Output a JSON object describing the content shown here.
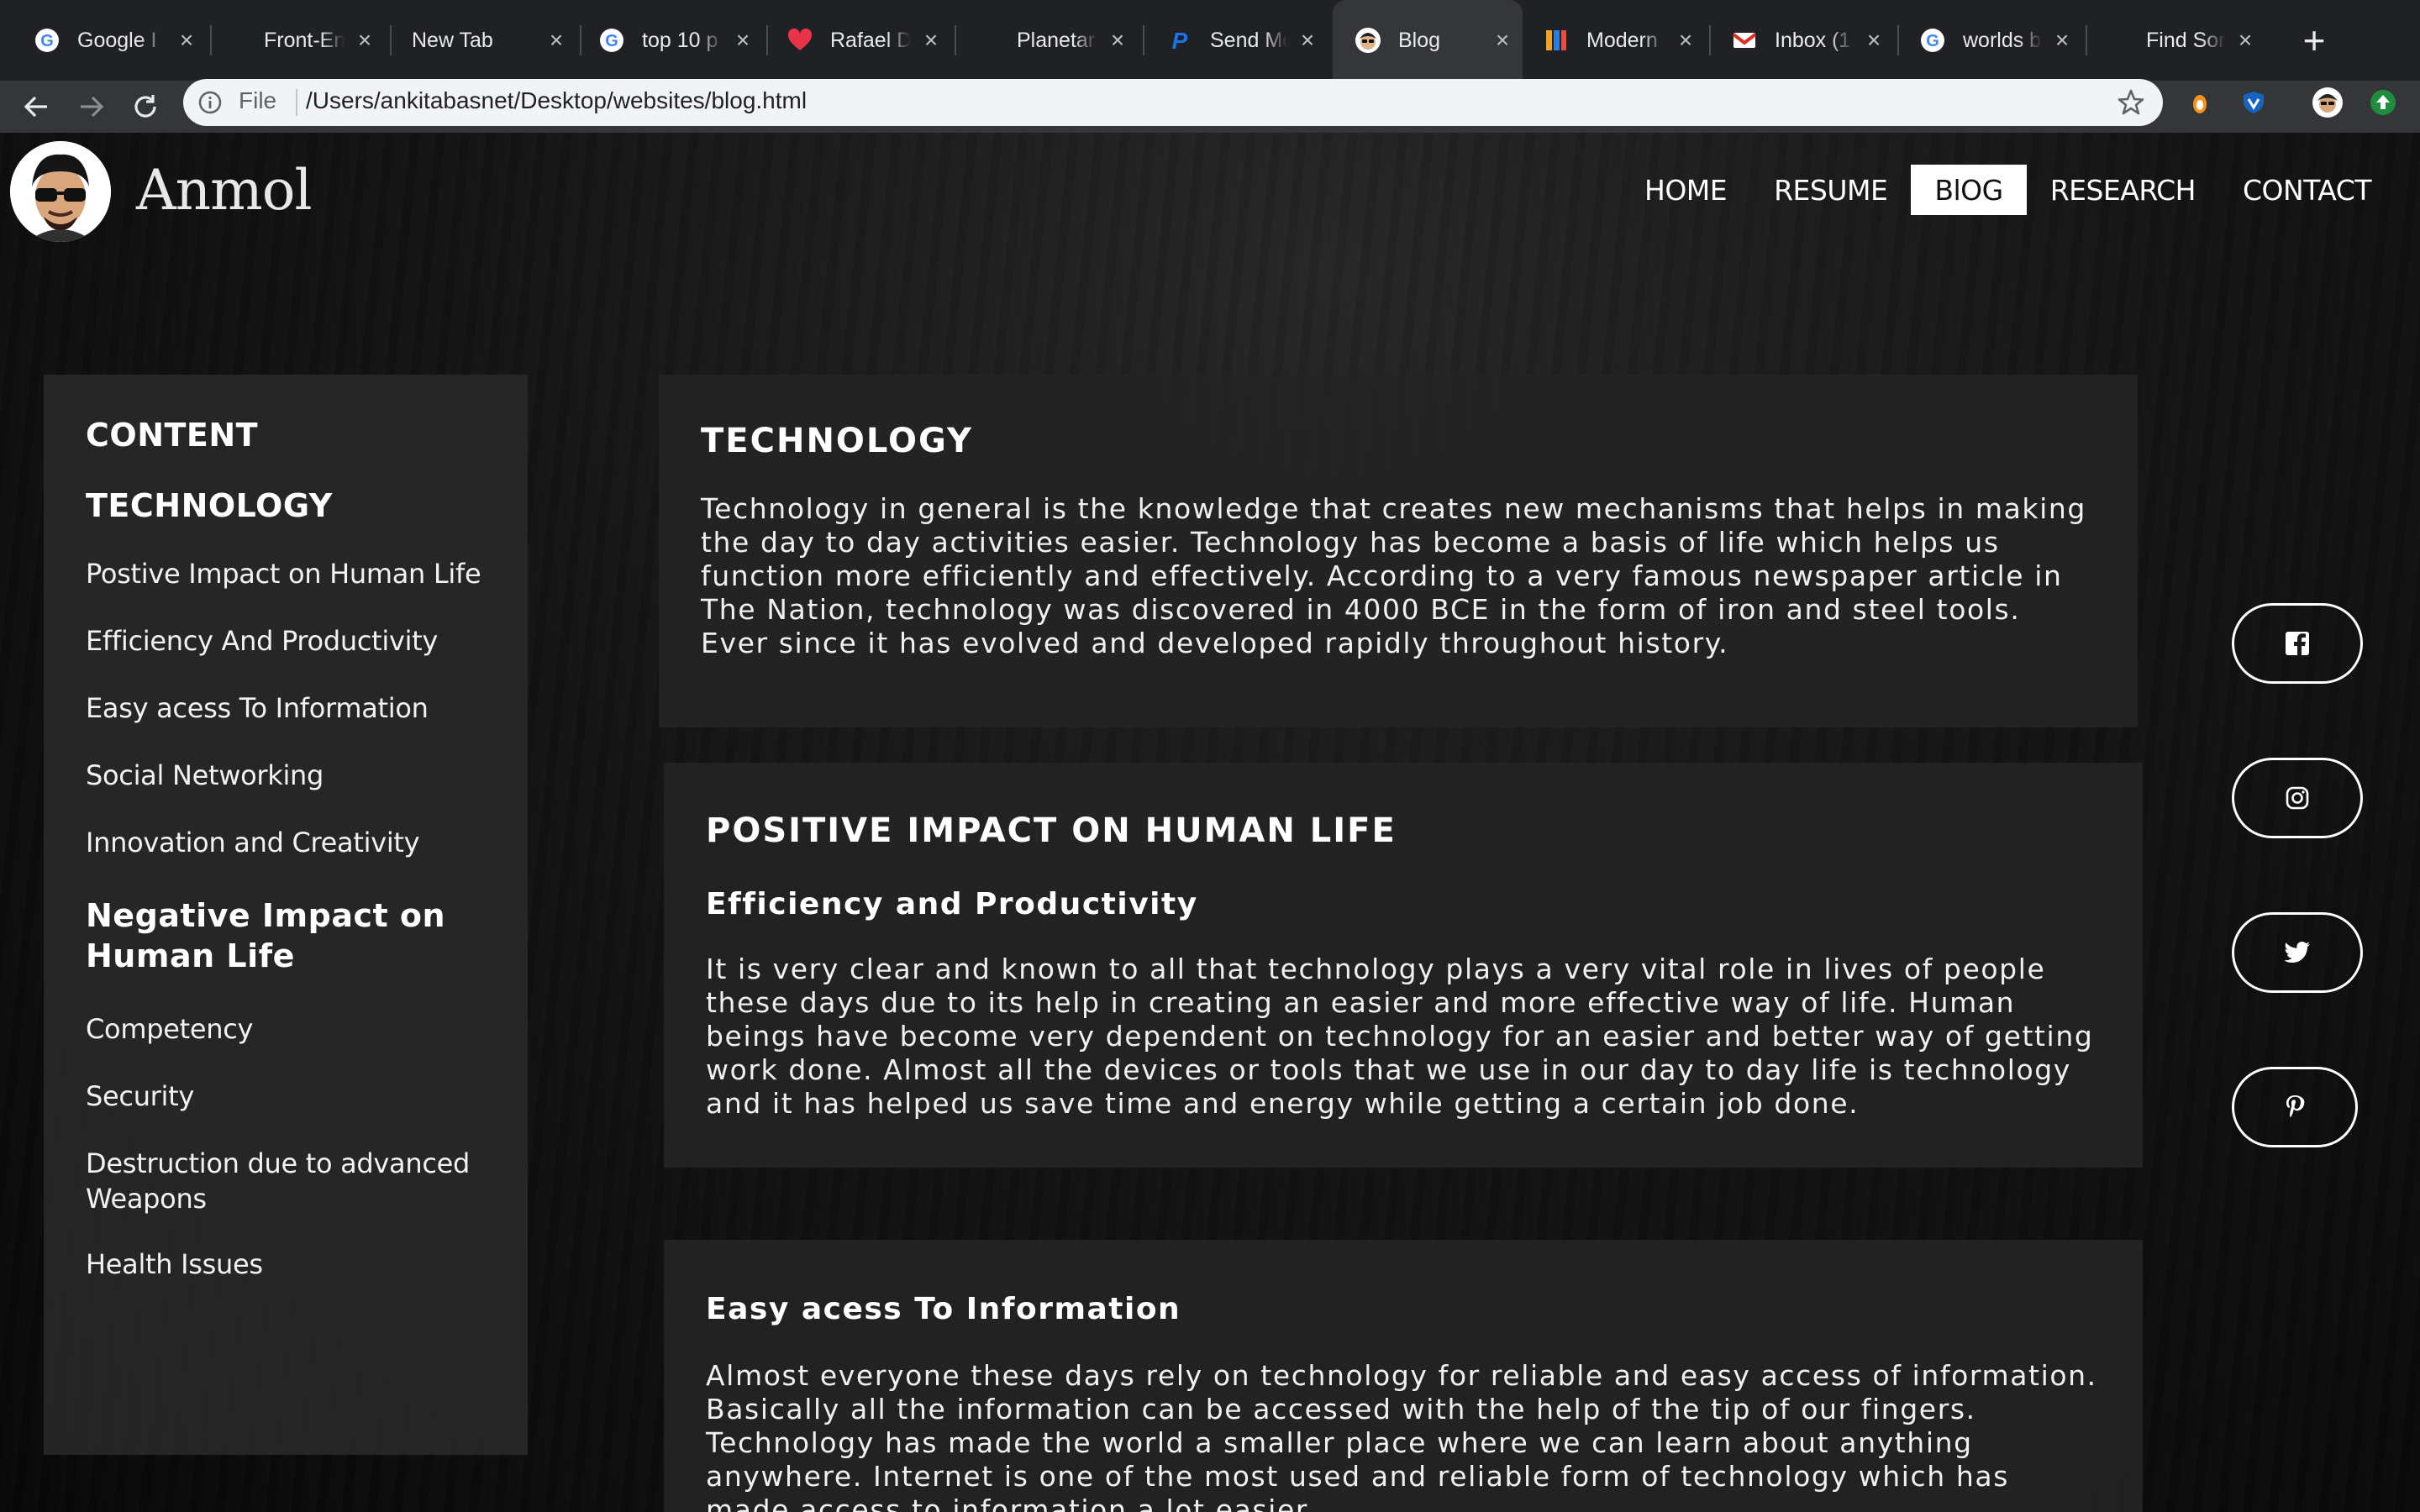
{
  "browser": {
    "tabs": [
      {
        "title": "Google I",
        "icon": "google-icon"
      },
      {
        "title": "Front-En",
        "icon": "none"
      },
      {
        "title": "New Tab",
        "icon": "none"
      },
      {
        "title": "top 10 p",
        "icon": "google-icon"
      },
      {
        "title": "Rafael D",
        "icon": "heart-icon"
      },
      {
        "title": "Planetar",
        "icon": "none"
      },
      {
        "title": "Send Mo",
        "icon": "paypal-icon"
      },
      {
        "title": "Blog",
        "icon": "avatar-icon",
        "active": true
      },
      {
        "title": "Modern",
        "icon": "app-icon"
      },
      {
        "title": "Inbox (1,",
        "icon": "gmail-icon"
      },
      {
        "title": "worlds b",
        "icon": "google-icon"
      },
      {
        "title": "Find Sor",
        "icon": "none"
      }
    ],
    "address_scheme": "File",
    "address_url": "/Users/ankitabasnet/Desktop/websites/blog.html"
  },
  "site": {
    "brand": "Anmol",
    "nav": [
      "HOME",
      "RESUME",
      "BlOG",
      "RESEARCH",
      "CONTACT"
    ],
    "active_nav": "BlOG"
  },
  "toc": {
    "heading": "CONTENT",
    "section1": "TECHNOLOGY",
    "items1": [
      "Postive Impact on Human Life",
      "Efficiency And Productivity",
      "Easy acess To Information",
      "Social Networking",
      "Innovation and Creativity"
    ],
    "section2": "Negative Impact on Human Life",
    "items2": [
      "Competency",
      "Security",
      "Destruction due to advanced Weapons",
      "Health Issues"
    ]
  },
  "articles": {
    "tech_title": "TECHNOLOGY",
    "tech_body": "Technology in general is the knowledge that creates new mechanisms that helps in making the day to day activities easier. Technology has become a basis of life which helps us function more efficiently and effectively. According to a very famous newspaper article in The Nation, technology was discovered in 4000 BCE in the form of iron and steel tools. Ever since it has evolved and developed rapidly throughout history.",
    "positive_title": "POSITIVE IMPACT ON HUMAN LIFE",
    "efficiency_title": "Efficiency and Productivity",
    "efficiency_body": "It is very clear and known to all that technology plays a very vital role in lives of people these days due to its help in creating an easier and more effective way of life. Human beings have become very dependent on technology for an easier and better way of getting work done. Almost all the devices or tools that we use in our day to day life is technology and it has helped us save time and energy while getting a certain job done.",
    "access_title": "Easy acess To Information",
    "access_body": "Almost everyone these days rely on technology for reliable and easy access of information. Basically all the information can be accessed with the help of the tip of our fingers. Technology has made the world a smaller place where we can learn about anything anywhere. Internet is one of the most used and reliable form of technology which has made access to information a lot easier."
  },
  "social": [
    "facebook-icon",
    "instagram-icon",
    "twitter-icon",
    "pinterest-icon"
  ]
}
